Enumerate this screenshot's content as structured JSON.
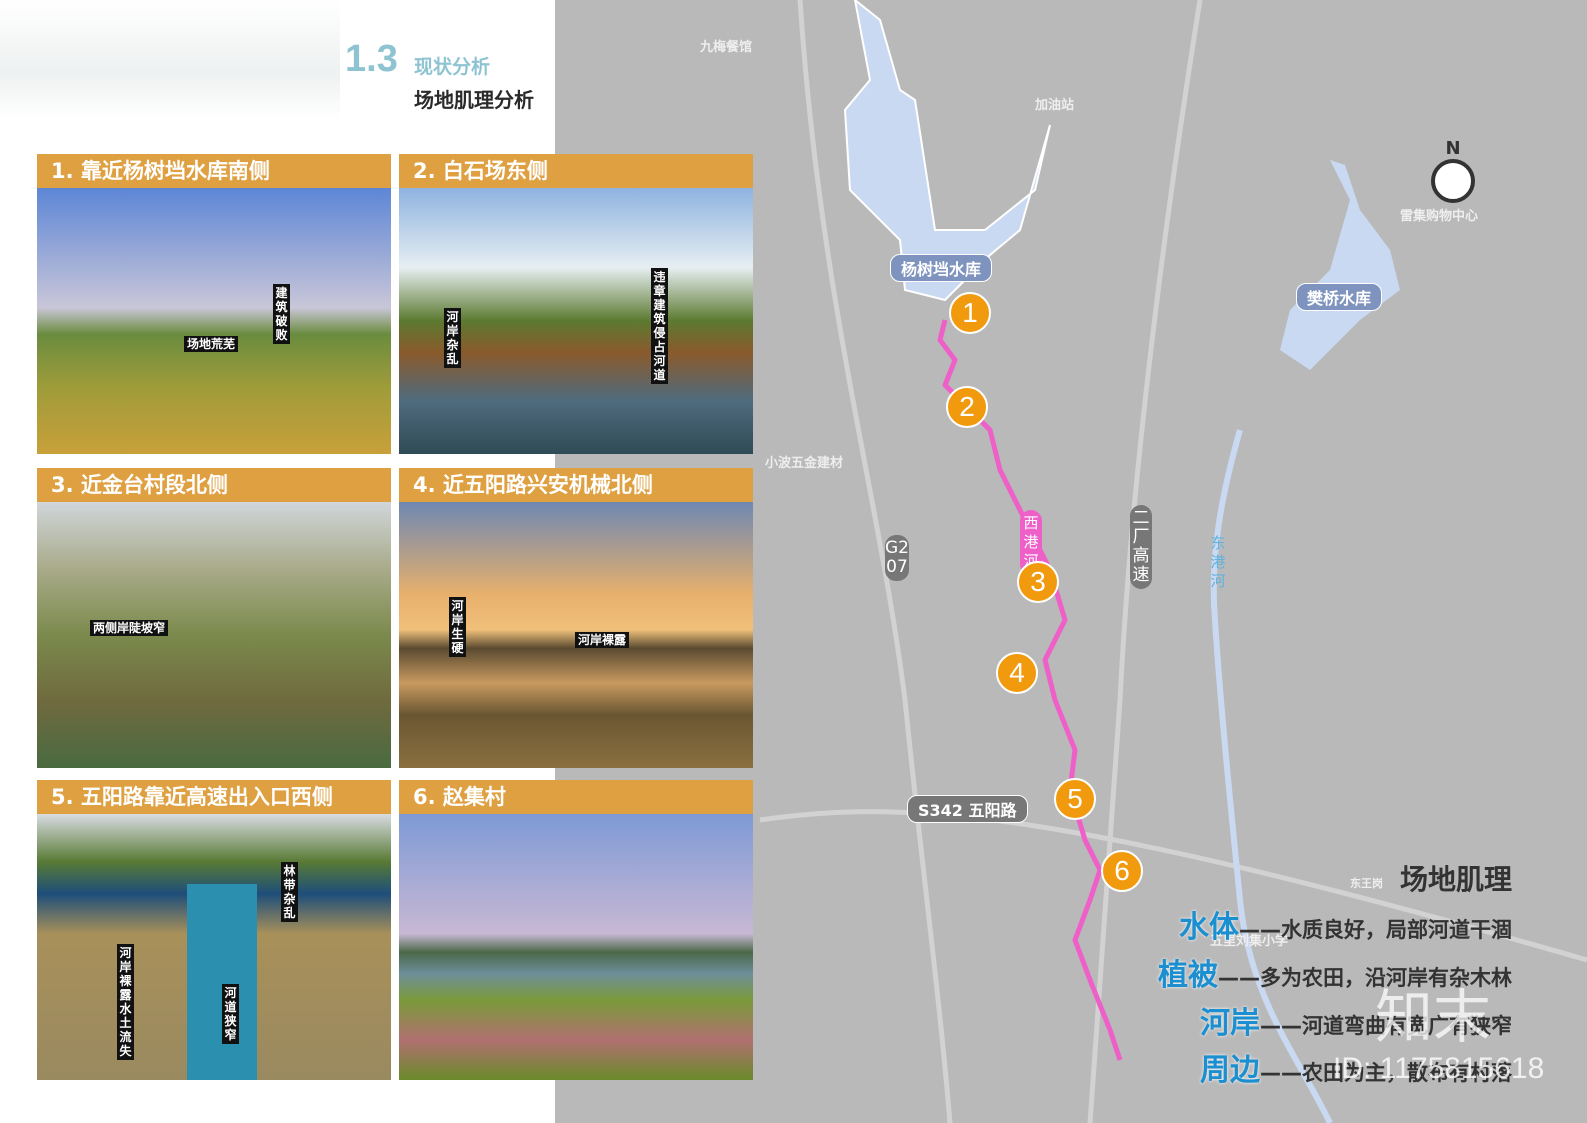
{
  "header": {
    "section_number": "1.3",
    "section_title": "现状分析",
    "page_title": "场地肌理分析"
  },
  "photos": [
    {
      "title": "1. 靠近杨树垱水库南侧",
      "notes": [
        "场地荒芜",
        "建筑破败"
      ]
    },
    {
      "title": "2. 白石场东侧",
      "notes": [
        "河岸杂乱",
        "违章建筑侵占河道"
      ]
    },
    {
      "title": "3. 近金台村段北侧",
      "notes": [
        "两侧岸陡坡窄"
      ]
    },
    {
      "title": "4. 近五阳路兴安机械北侧",
      "notes": [
        "河岸生硬",
        "河岸裸露"
      ]
    },
    {
      "title": "5. 五阳路靠近高速出入口西侧",
      "notes": [
        "林带杂乱",
        "河岸裸露水土流失",
        "河道狭窄"
      ]
    },
    {
      "title": "6. 赵集村",
      "notes": []
    }
  ],
  "map": {
    "places": [
      "九梅餐馆",
      "加油站",
      "小波五金建材",
      "雷集购物中心",
      "五里刘集小学",
      "东王岗"
    ],
    "water": [
      "杨树垱水库",
      "樊桥水库"
    ],
    "rivers": [
      "西港河",
      "东港河"
    ],
    "roads": [
      "G207",
      "二厂高速",
      "S342 五阳路"
    ],
    "markers": [
      "1",
      "2",
      "3",
      "4",
      "5",
      "6"
    ],
    "north": "N",
    "river_color": "#ee5fc8",
    "marker_color": "#f29a0e",
    "water_color": "#c9d9f2"
  },
  "legend": {
    "title": "场地肌理",
    "items": [
      {
        "key": "水体",
        "desc": "——水质良好，局部河道干涸"
      },
      {
        "key": "植被",
        "desc": "——多为农田，沿河岸有杂木林"
      },
      {
        "key": "河岸",
        "desc": "——河道弯曲有宽广有狭窄"
      },
      {
        "key": "周边",
        "desc": "——农田为主，散布有村落"
      }
    ]
  },
  "watermark": {
    "logo": "知末",
    "id": "ID: 1175815618"
  }
}
